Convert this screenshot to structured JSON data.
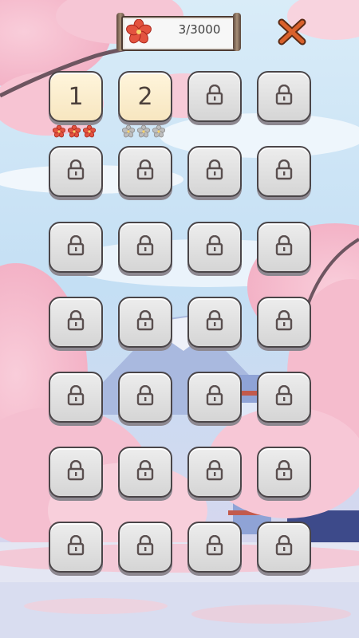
{
  "header": {
    "score_text": "3/3000",
    "flower_icon": "cherry-blossom-icon",
    "close_icon": "close-icon"
  },
  "colors": {
    "sky_top": "#cfe6f7",
    "blossom": "#f5b9cc",
    "star_filled": "#e3533f",
    "star_empty": "#bdbdbd",
    "close_x": "#cf5a2a",
    "tile_unlocked": "#f8e9c6",
    "tile_locked": "#dcdcdc"
  },
  "levels": [
    {
      "label": "1",
      "locked": false,
      "stars": 3
    },
    {
      "label": "2",
      "locked": false,
      "stars": 0
    },
    {
      "label": "",
      "locked": true
    },
    {
      "label": "",
      "locked": true
    },
    {
      "label": "",
      "locked": true
    },
    {
      "label": "",
      "locked": true
    },
    {
      "label": "",
      "locked": true
    },
    {
      "label": "",
      "locked": true
    },
    {
      "label": "",
      "locked": true
    },
    {
      "label": "",
      "locked": true
    },
    {
      "label": "",
      "locked": true
    },
    {
      "label": "",
      "locked": true
    },
    {
      "label": "",
      "locked": true
    },
    {
      "label": "",
      "locked": true
    },
    {
      "label": "",
      "locked": true
    },
    {
      "label": "",
      "locked": true
    },
    {
      "label": "",
      "locked": true
    },
    {
      "label": "",
      "locked": true
    },
    {
      "label": "",
      "locked": true
    },
    {
      "label": "",
      "locked": true
    },
    {
      "label": "",
      "locked": true
    },
    {
      "label": "",
      "locked": true
    },
    {
      "label": "",
      "locked": true
    },
    {
      "label": "",
      "locked": true
    },
    {
      "label": "",
      "locked": true
    },
    {
      "label": "",
      "locked": true
    },
    {
      "label": "",
      "locked": true
    },
    {
      "label": "",
      "locked": true
    }
  ]
}
